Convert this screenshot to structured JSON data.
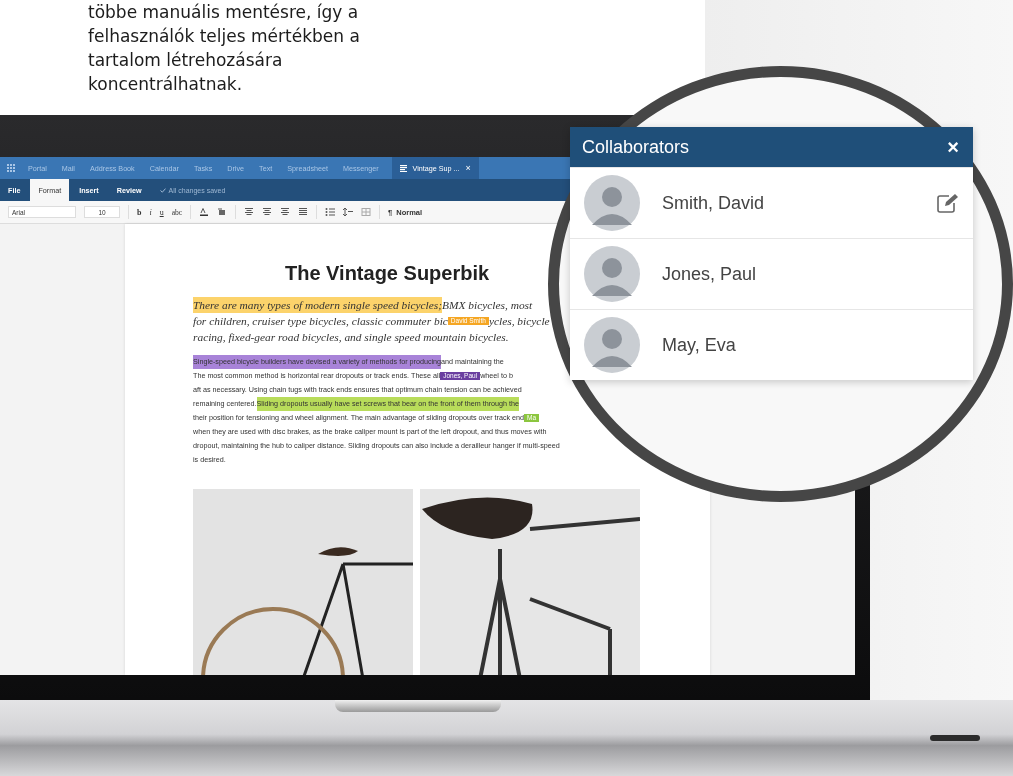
{
  "intro": {
    "lines": [
      "többe manuális mentésre, így a",
      "felhasználók teljes mértékben a",
      "tartalom létrehozására",
      "koncentrálhatnak."
    ]
  },
  "app": {
    "nav": {
      "tabs": [
        {
          "label": "Portal",
          "selected": false
        },
        {
          "label": "Mail",
          "selected": false
        },
        {
          "label": "Address Book",
          "selected": false
        },
        {
          "label": "Calendar",
          "selected": false
        },
        {
          "label": "Tasks",
          "selected": false
        },
        {
          "label": "Drive",
          "selected": false
        },
        {
          "label": "Text",
          "selected": false
        },
        {
          "label": "Spreadsheet",
          "selected": false
        },
        {
          "label": "Messenger",
          "selected": false
        },
        {
          "label": "Vintage Sup ...",
          "selected": true,
          "close": "×"
        }
      ]
    },
    "menu": {
      "tabs": [
        {
          "label": "File",
          "selected": false
        },
        {
          "label": "Format",
          "selected": true
        },
        {
          "label": "Insert",
          "selected": false
        },
        {
          "label": "Review",
          "selected": false
        }
      ],
      "save_status": "All changes saved"
    },
    "toolbar": {
      "font": "Arial",
      "size": "10",
      "format_buttons": [
        "b",
        "i",
        "u",
        "abc"
      ],
      "paragraph_mark": "¶",
      "style": "Normal"
    },
    "document": {
      "title": "The Vintage Superbik",
      "intro_lines": [
        {
          "segments": [
            {
              "kind": "highlight",
              "text": "There are many types of modern single speed bicycles;",
              "color": "#fcd36b"
            },
            {
              "kind": "text",
              "text": " BMX bicycles, most"
            }
          ]
        },
        {
          "segments": [
            {
              "kind": "text",
              "text": "for children, cruiser type bicycles, classic commuter bic"
            },
            {
              "kind": "badge",
              "text": "David Smith",
              "color": "#f5a623"
            },
            {
              "kind": "text",
              "text": "ycles, bicycle"
            }
          ]
        },
        {
          "segments": [
            {
              "kind": "text",
              "text": "racing, fixed-gear road bicycles, and single speed mountain bicycles."
            }
          ]
        }
      ],
      "body_lines": [
        {
          "segments": [
            {
              "kind": "highlight",
              "text": "Single-speed bicycle builders have devised a variety of methods for producing",
              "color": "#a883d8"
            },
            {
              "kind": "text",
              "text": " and maintaining the"
            }
          ]
        },
        {
          "segments": [
            {
              "kind": "text",
              "text": "The most common method is horizontal rear dropouts or track ends. These all"
            },
            {
              "kind": "badge",
              "text": "Jones, Paul",
              "color": "#6a3fa0"
            },
            {
              "kind": "text",
              "text": " wheel to b"
            }
          ]
        },
        {
          "segments": [
            {
              "kind": "text",
              "text": "aft as necessary. Using chain tugs with track ends ensures that optimum chain tension can be achieved"
            }
          ]
        },
        {
          "segments": [
            {
              "kind": "text",
              "text": "remaining centered. "
            },
            {
              "kind": "highlight",
              "text": "Sliding dropouts usually have set screws that bear on the front of them through the",
              "color": "#b8dc5a"
            }
          ]
        },
        {
          "segments": [
            {
              "kind": "text",
              "text": "their position for tensioning and wheel alignment. The main advantage of sliding dropouts over track end"
            },
            {
              "kind": "badge",
              "text": "Ma",
              "color": "#8cc63f"
            }
          ]
        },
        {
          "segments": [
            {
              "kind": "text",
              "text": "when they are used with disc brakes, as the brake caliper mount is part of the left dropout, and thus moves with"
            }
          ]
        },
        {
          "segments": [
            {
              "kind": "text",
              "text": "dropout, maintaining the hub to caliper distance. Sliding dropouts can also include a derailleur hanger if multi-speed"
            }
          ]
        },
        {
          "segments": [
            {
              "kind": "text",
              "text": "is desired."
            }
          ]
        }
      ]
    }
  },
  "collaborators": {
    "title": "Collaborators",
    "close": "×",
    "people": [
      {
        "name": "Smith, David",
        "editing": true
      },
      {
        "name": "Jones, Paul",
        "editing": false
      },
      {
        "name": "May, Eva",
        "editing": false
      }
    ]
  }
}
